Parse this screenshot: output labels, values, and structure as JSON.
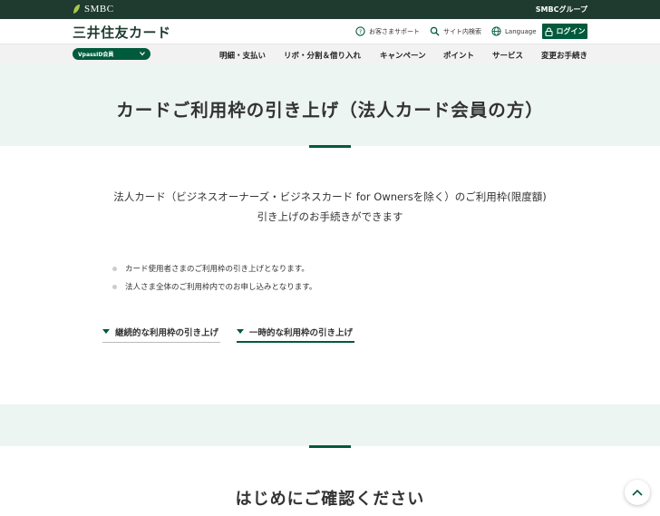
{
  "top_bar": {
    "smbc_label": "SMBC",
    "group_label": "SMBCグループ"
  },
  "header": {
    "brand": "三井住友カード",
    "support_label": "お客さまサポート",
    "search_label": "サイト内検索",
    "language_label": "Language",
    "login_label": "ログイン"
  },
  "nav": {
    "vpass_label": "VpassID会員",
    "items": [
      "明細・支払い",
      "リボ・分割＆借り入れ",
      "キャンペーン",
      "ポイント",
      "サービス",
      "変更お手続き"
    ]
  },
  "hero": {
    "title": "カードご利用枠の引き上げ（法人カード会員の方）"
  },
  "main": {
    "lead_line1": "法人カード（ビジネスオーナーズ・ビジネスカード for Ownersを除く）のご利用枠(限度額)",
    "lead_line2": "引き上げのお手続きができます",
    "bullets": [
      "カード使用者さまのご利用枠の引き上げとなります。",
      "法人さま全体のご利用枠内でのお申し込みとなります。"
    ],
    "anchors": [
      "継続的な利用枠の引き上げ",
      "一時的な利用枠の引き上げ"
    ]
  },
  "section": {
    "title": "はじめにご確認ください"
  },
  "colors": {
    "brand_dark": "#1f3b2f",
    "brand_green": "#005a3c",
    "hero_bg": "#edf5f2"
  },
  "icons": [
    "leaf-icon",
    "support-icon",
    "search-icon",
    "globe-icon",
    "lock-icon",
    "chevron-down-icon",
    "triangle-down-icon",
    "chevron-up-icon"
  ]
}
